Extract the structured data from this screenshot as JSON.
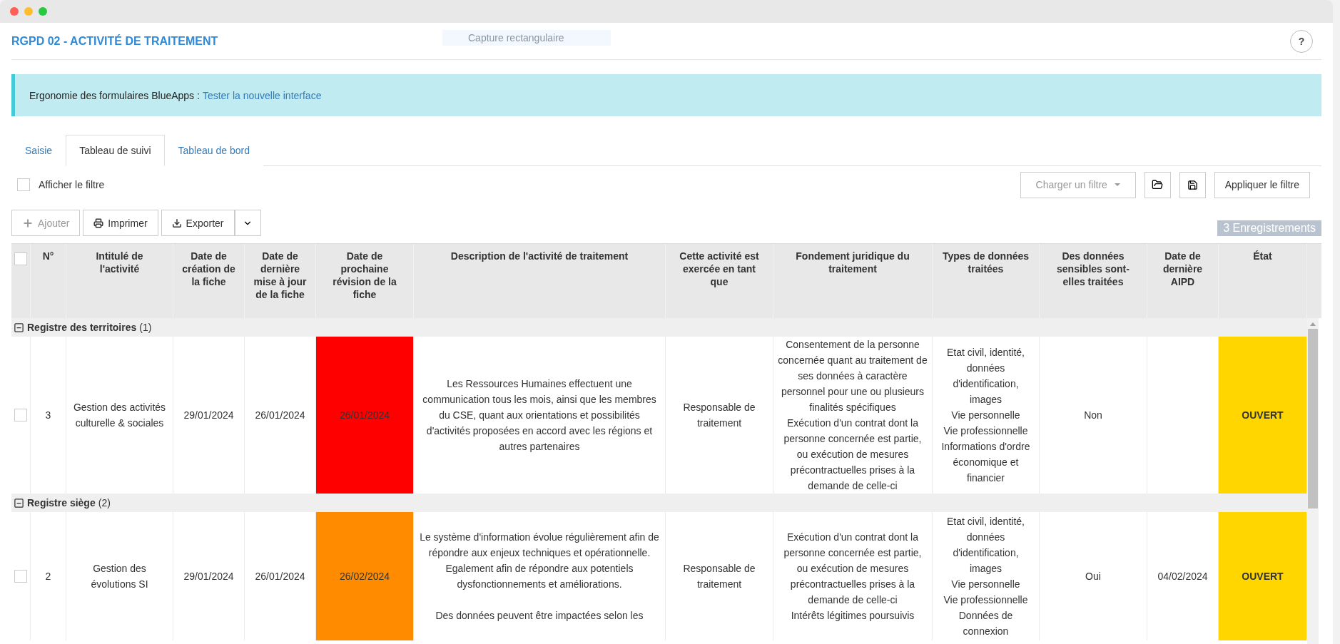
{
  "page": {
    "title": "RGPD 02 - ACTIVITÉ DE TRAITEMENT",
    "help": "?"
  },
  "capture_tooltip": "Capture rectangulaire",
  "banner": {
    "text": "Ergonomie des formulaires BlueApps :",
    "link": "Tester la nouvelle interface"
  },
  "tabs": [
    {
      "label": "Saisie",
      "selected": false
    },
    {
      "label": "Tableau de suivi",
      "selected": true
    },
    {
      "label": "Tableau de bord",
      "selected": false
    }
  ],
  "filter": {
    "label": "Afficher le filtre",
    "checked": false,
    "load_placeholder": "Charger un filtre",
    "apply": "Appliquer le filtre"
  },
  "toolbar": [
    {
      "label": "Ajouter",
      "kind": "add",
      "disabled": true
    },
    {
      "label": "Imprimer",
      "kind": "print",
      "disabled": false
    },
    {
      "label": "Exporter",
      "kind": "export",
      "disabled": false
    }
  ],
  "record_count": "3 Enregistrements",
  "table": {
    "select_all_checked": false,
    "columns": [
      "N°",
      "Intitulé de l'activité",
      "Date de création de la fiche",
      "Date de dernière mise à jour de la fiche",
      "Date de prochaine révision de la fiche",
      "Description de l'activité de traitement",
      "Cette activité est exercée en tant que",
      "Fondement juridique du traitement",
      "Types de données traitées",
      "Des données sensibles sont-elles traitées",
      "Date de dernière AIPD",
      "État"
    ],
    "groups": [
      {
        "label": "Registre des territoires",
        "count": "(1)",
        "expanded": true,
        "rows": [
          {
            "checked": false,
            "number": "3",
            "title": "Gestion des activités culturelle & sociales",
            "created": "29/01/2024",
            "updated": "26/01/2024",
            "next_review": {
              "date": "26/01/2024",
              "color": "#ff0000"
            },
            "description": [
              "Les Ressources Humaines effectuent une communication tous les mois, ainsi que les membres du CSE, quant aux orientations et possibilités d'activités proposées en accord avec les régions et autres partenaires"
            ],
            "role": "Responsable de traitement",
            "legal_basis": [
              "Consentement de la personne concernée quant au traitement de ses données à caractère personnel pour une ou plusieurs finalités spécifiques",
              "Exécution d'un contrat dont la personne concernée est partie, ou exécution de mesures précontractuelles prises à la demande de celle-ci"
            ],
            "data_types": [
              "Etat civil, identité, données d'identification, images",
              "Vie personnelle",
              "Vie professionnelle",
              "Informations d'ordre économique et financier"
            ],
            "sensitive": "Non",
            "last_aipd": "",
            "status": {
              "label": "OUVERT",
              "color": "#ffd600"
            }
          }
        ]
      },
      {
        "label": "Registre siège",
        "count": "(2)",
        "expanded": true,
        "rows": [
          {
            "checked": false,
            "number": "2",
            "title": "Gestion des évolutions SI",
            "created": "29/01/2024",
            "updated": "26/01/2024",
            "next_review": {
              "date": "26/02/2024",
              "color": "#ff8c00"
            },
            "description": [
              "Le système d'information évolue régulièrement afin de répondre aux enjeux techniques et opérationnelle. Egalement afin de répondre aux potentiels dysfonctionnements et améliorations.",
              "Des données peuvent être impactées selon les"
            ],
            "role": "Responsable de traitement",
            "legal_basis": [
              "Exécution d'un contrat dont la personne concernée est partie, ou exécution de mesures précontractuelles prises à la demande de celle-ci",
              "Intérêts légitimes poursuivis"
            ],
            "data_types": [
              "Etat civil, identité, données d'identification, images",
              "Vie personnelle",
              "Vie professionnelle",
              "Données de connexion"
            ],
            "sensitive": "Oui",
            "last_aipd": "04/02/2024",
            "status": {
              "label": "OUVERT",
              "color": "#ffd600"
            }
          }
        ]
      }
    ]
  }
}
